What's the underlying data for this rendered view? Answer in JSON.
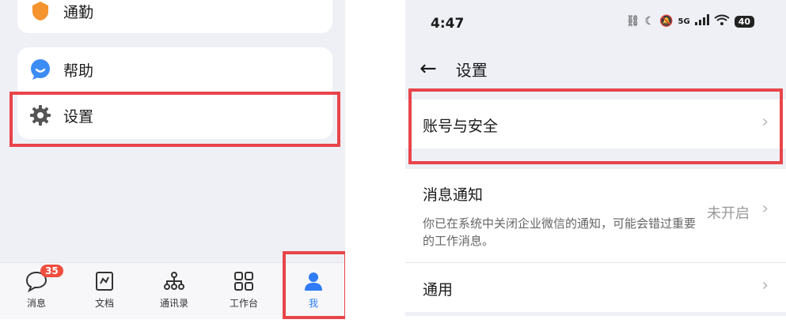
{
  "left": {
    "menu": {
      "commute": "通勤",
      "help": "帮助",
      "settings": "设置"
    },
    "tabs": [
      {
        "label": "消息",
        "badge": "35",
        "icon": "chat-bubble-icon"
      },
      {
        "label": "文档",
        "icon": "document-icon"
      },
      {
        "label": "通讯录",
        "icon": "org-chart-icon"
      },
      {
        "label": "工作台",
        "icon": "grid-apps-icon"
      },
      {
        "label": "我",
        "icon": "person-icon",
        "active": true
      }
    ]
  },
  "right": {
    "time": "4:47",
    "battery": "40",
    "network": "5G",
    "title": "设置",
    "items": {
      "account": "账号与安全",
      "notifications": "消息通知",
      "notifications_value": "未开启",
      "notifications_desc": "你已在系统中关闭企业微信的通知，可能会错过重要的工作消息。",
      "general": "通用"
    }
  },
  "colors": {
    "highlight": "#e8454a",
    "brand_blue": "#2f7cf6",
    "commute_orange": "#f5932e",
    "badge_red": "#f04d3e"
  }
}
